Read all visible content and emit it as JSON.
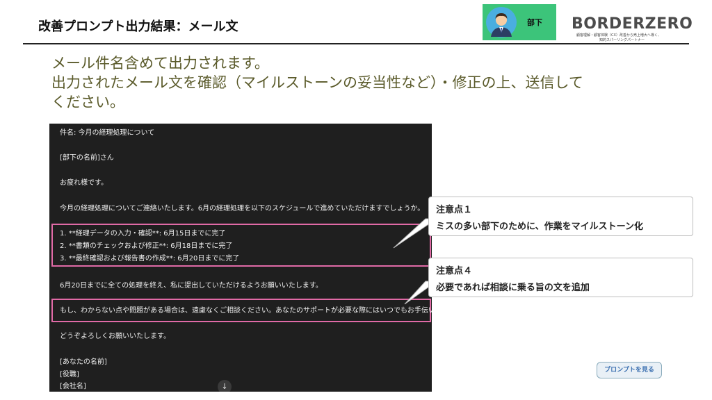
{
  "header": {
    "title": "改善プロンプト出力結果：メール文"
  },
  "badge": {
    "label": "部下",
    "avatar_icon": "subordinate-avatar-icon",
    "color": "#3cc47a"
  },
  "logo": {
    "text": "BORDERZERO",
    "sub1": "顧客理解・顧客体験（CX）改善から売上増大へ導く、",
    "sub2": "知的スパーリングパートナー"
  },
  "intro": {
    "line1": "メール件名含めて出力されます。",
    "line2": "出力されたメール文を確認（マイルストーンの妥当性など）・修正の上、送信して",
    "line3": "ください。"
  },
  "mail": {
    "subject": "件名: 今月の経理処理について",
    "greeting": "[部下の名前]さん",
    "opening": "お疲れ様です。",
    "intro": "今月の経理処理についてご連絡いたします。6月の経理処理を以下のスケジュールで進めていただけますでしょうか。",
    "steps": [
      "1. **経理データの入力・確認**: 6月15日までに完了",
      "2. **書類のチェックおよび修正**: 6月18日までに完了",
      "3. **最終確認および報告書の作成**: 6月20日までに完了"
    ],
    "deadline": "6月20日までに全ての処理を終え、私に提出していただけるようお願いいたします。",
    "support": "もし、わからない点や問題がある場合は、遠慮なくご相談ください。あなたのサポートが必要な際にはいつでもお手伝いし",
    "closing": "どうぞよろしくお願いいたします。",
    "sig_name": "[あなたの名前]",
    "sig_title": "[役職]",
    "sig_company": "[会社名]",
    "scroll_icon": "arrow-down-icon"
  },
  "callouts": [
    {
      "title": "注意点１",
      "body": "ミスの多い部下のために、作業をマイルストーン化"
    },
    {
      "title": "注意点４",
      "body": "必要であれば相談に乗る旨の文を追加"
    }
  ],
  "colors": {
    "highlight": "#e06aa6",
    "intro_text": "#5a5a2a",
    "mail_bg": "#1f1f1f"
  },
  "prompt_button": {
    "label": "プロンプトを見る"
  }
}
